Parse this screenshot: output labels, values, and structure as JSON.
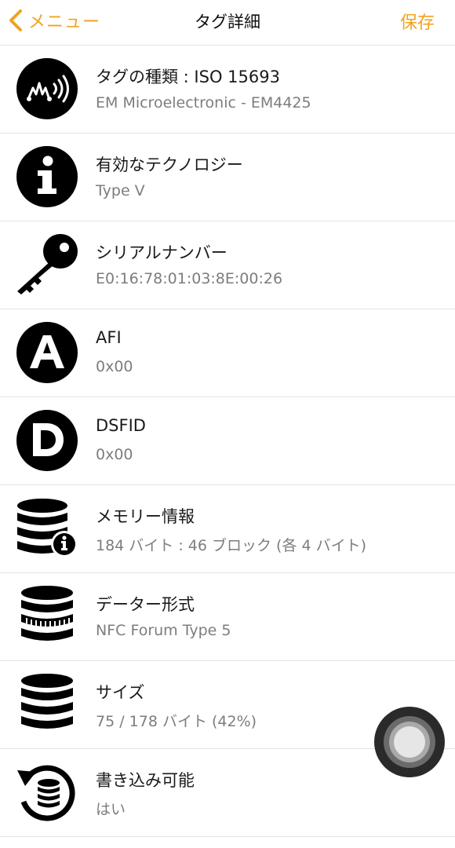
{
  "colors": {
    "accent": "#f0a31f",
    "title_text": "#1a1a1a",
    "value_text": "#7d7d7d",
    "separator": "#e4e4e4"
  },
  "navbar": {
    "back_icon": "chevron-left-icon",
    "back_label": "メニュー",
    "title": "タグ詳細",
    "save_label": "保存"
  },
  "rows": [
    {
      "icon": "nfc-tag-icon",
      "title": "タグの種類 : ISO 15693",
      "value": "EM Microelectronic - EM4425"
    },
    {
      "icon": "info-icon",
      "title": "有効なテクノロジー",
      "value": "Type V"
    },
    {
      "icon": "key-icon",
      "title": "シリアルナンバー",
      "value": "E0:16:78:01:03:8E:00:26"
    },
    {
      "icon": "letter-a-icon",
      "title": "AFI",
      "value": "0x00"
    },
    {
      "icon": "letter-d-icon",
      "title": "DSFID",
      "value": "0x00"
    },
    {
      "icon": "database-info-icon",
      "title": "メモリー情報",
      "value": "184 バイト : 46 ブロック (各 4 バイト)"
    },
    {
      "icon": "database-format-icon",
      "title": "データー形式",
      "value": "NFC Forum Type 5"
    },
    {
      "icon": "database-icon",
      "title": "サイズ",
      "value": "75 / 178 バイト (42%)"
    },
    {
      "icon": "database-refresh-icon",
      "title": "書き込み可能",
      "value": "はい"
    }
  ],
  "assistive_touch": {
    "icon": "assistive-touch-icon"
  }
}
